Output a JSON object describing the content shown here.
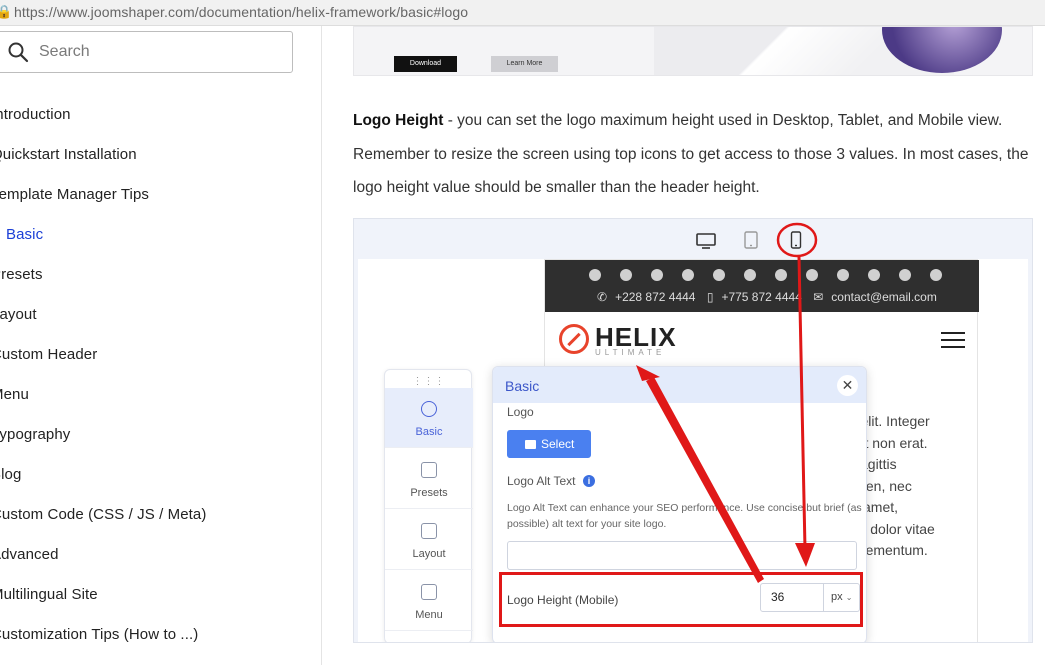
{
  "browser": {
    "url": "https://www.joomshaper.com/documentation/helix-framework/basic#logo"
  },
  "sidebar": {
    "search_placeholder": "Search",
    "items": [
      {
        "label": "Introduction"
      },
      {
        "label": "Quickstart Installation"
      },
      {
        "label": "Template Manager Tips"
      },
      {
        "label": "Basic",
        "active": true
      },
      {
        "label": "Presets"
      },
      {
        "label": "Layout"
      },
      {
        "label": "Custom Header"
      },
      {
        "label": "Menu"
      },
      {
        "label": "Typography"
      },
      {
        "label": "Blog"
      },
      {
        "label": "Custom Code (CSS / JS / Meta)"
      },
      {
        "label": "Advanced"
      },
      {
        "label": "Multilingual Site"
      },
      {
        "label": "Customization Tips (How to ...)"
      }
    ]
  },
  "hero": {
    "download_label": "Download",
    "learn_label": "Learn More"
  },
  "article": {
    "term": "Logo Height",
    "text": " - you can set the logo maximum height used in Desktop, Tablet, and Mobile view. Remember to resize the screen using top icons to get access to those 3 values. In most cases, the logo height value should be smaller than the header height."
  },
  "screenshot": {
    "devices": [
      "desktop-icon",
      "tablet-icon",
      "mobile-icon"
    ],
    "contact": {
      "phone1": "+228 872 4444",
      "phone2": "+775 872 4444",
      "email": "contact@email.com"
    },
    "logo": {
      "name": "HELIX",
      "sub": "ULTIMATE"
    },
    "site_text": [
      "ng elit. Integer",
      "e et non erat.",
      "sagittis",
      "pien, nec",
      "amet,",
      "que dolor vitae",
      "n elementum."
    ],
    "panel_items": [
      {
        "label": "Basic",
        "active": true
      },
      {
        "label": "Presets"
      },
      {
        "label": "Layout"
      },
      {
        "label": "Menu"
      }
    ],
    "modal": {
      "title": "Basic",
      "close": "✕",
      "logo_label": "Logo",
      "select_label": "Select",
      "alt_label": "Logo Alt Text",
      "alt_help": "Logo Alt Text can enhance your SEO performance. Use concise but brief (as possible) alt text for your site logo.",
      "height_label": "Logo Height (Mobile)",
      "height_value": "36",
      "unit": "px"
    },
    "highlight_color": "#e01818"
  }
}
